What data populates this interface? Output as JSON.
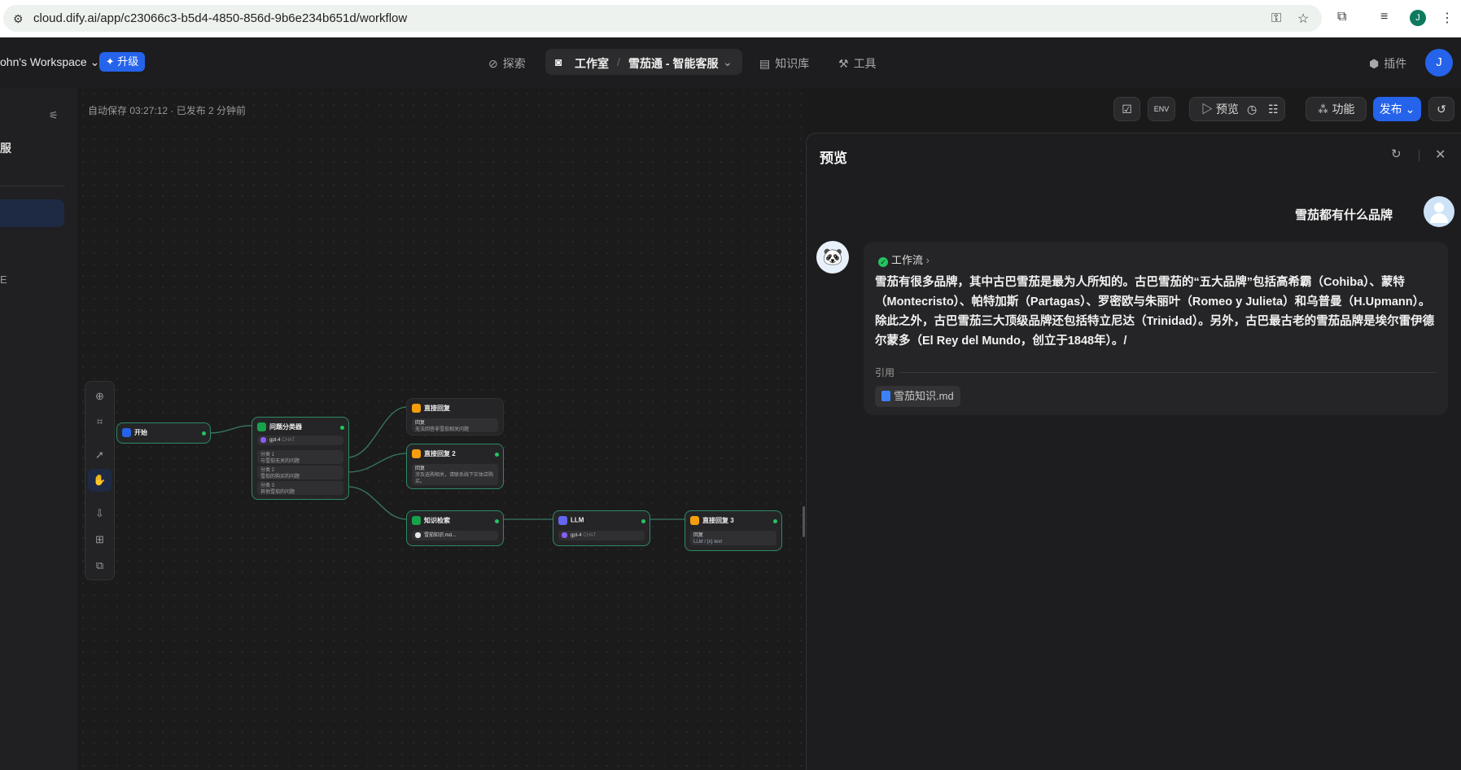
{
  "browser": {
    "url": "cloud.dify.ai/app/c23066c3-b5d4-4850-856d-9b6e234b651d/workflow",
    "profile_initial": "J"
  },
  "header": {
    "workspace": "ohn's Workspace",
    "upgrade": "✦ 升级",
    "nav": {
      "explore": "探索",
      "studio": "工作室",
      "app_name": "雪茄通 - 智能客服",
      "knowledge": "知识库",
      "tools": "工具",
      "plugins": "插件"
    },
    "avatar_initial": "J"
  },
  "sidebar": {
    "app_title_fragment": "服",
    "item_fragment": "E"
  },
  "canvas": {
    "autosave": "自动保存 03:27:12 · 已发布 2 分钟前",
    "toolbar": {
      "env": "ENV",
      "preview": "预览",
      "features": "功能",
      "publish": "发布"
    },
    "nodes": {
      "start": {
        "title": "开始"
      },
      "classifier": {
        "title": "问题分类器",
        "model": "gpt-4",
        "model_tag": "CHAT",
        "classes": [
          {
            "label": "分类 1",
            "text": "与雪茄无关的问题"
          },
          {
            "label": "分类 2",
            "text": "雪茄的购买的问题"
          },
          {
            "label": "分类 3",
            "text": "其他雪茄的问题"
          }
        ]
      },
      "answer1": {
        "title": "直接回复",
        "label": "回复",
        "text": "无法回答非雪茄相关问题"
      },
      "answer2": {
        "title": "直接回复 2",
        "label": "回复",
        "text": "涉及选购相关，请联系线下实体店购买。"
      },
      "knowledge": {
        "title": "知识检索",
        "file": "雪茄知识.md..."
      },
      "llm": {
        "title": "LLM",
        "model": "gpt-4",
        "model_tag": "CHAT"
      },
      "answer3": {
        "title": "直接回复 3",
        "label": "回复",
        "text": "LLM / {x} text"
      }
    }
  },
  "preview": {
    "title": "预览",
    "question": "雪茄都有什么品牌",
    "workflow_badge": "工作流",
    "answer": "雪茄有很多品牌，其中古巴雪茄是最为人所知的。古巴雪茄的“五大品牌”包括高希霸（Cohiba）、蒙特（Montecristo）、帕特加斯（Partagas）、罗密欧与朱丽叶（Romeo y Julieta）和乌普曼（H.Upmann）。除此之外，古巴雪茄三大顶级品牌还包括特立尼达（Trinidad）。另外，古巴最古老的雪茄品牌是埃尔雷伊德尔蒙多（El Rey del Mundo，创立于1848年）。/",
    "cite_label": "引用",
    "cite_file": "雪茄知识.md"
  }
}
